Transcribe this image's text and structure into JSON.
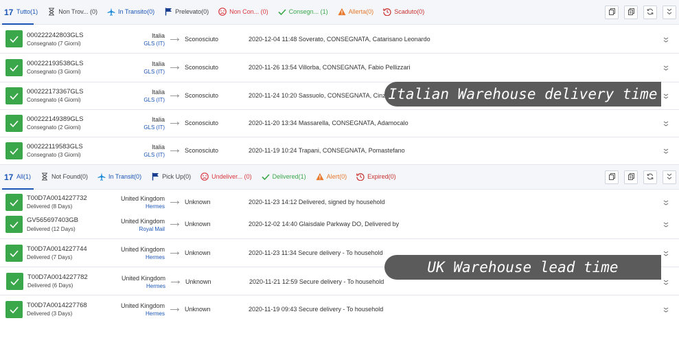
{
  "italy": {
    "tabs": [
      {
        "label": "Tutto(1)",
        "icon": "logo-17track-icon",
        "active": true
      },
      {
        "label": "Non Trov... (0)",
        "icon": "hourglass-icon"
      },
      {
        "label": "In Transito(0)",
        "icon": "plane-icon"
      },
      {
        "label": "Prelevato(0)",
        "icon": "flag-icon"
      },
      {
        "label": "Non Con... (0)",
        "icon": "sad-face-icon"
      },
      {
        "label": "Consegn... (1)",
        "icon": "check-icon"
      },
      {
        "label": "Allerta(0)",
        "icon": "warning-icon"
      },
      {
        "label": "Scaduto(0)",
        "icon": "history-icon"
      }
    ],
    "rows": [
      {
        "number": "000222242803GLS",
        "status": "Consegnato (7 Giorni)",
        "country": "Italia",
        "carrier": "GLS (IT)",
        "destination": "Sconosciuto",
        "event": "2020-12-04 11:48  Soverato, CONSEGNATA, Catarisano Leonardo"
      },
      {
        "number": "000222193538GLS",
        "status": "Consegnato (3 Giorni)",
        "country": "Italia",
        "carrier": "GLS (IT)",
        "destination": "Sconosciuto",
        "event": "2020-11-26 13:54  Villorba, CONSEGNATA, Fabio Pellizzari"
      },
      {
        "number": "000222173367GLS",
        "status": "Consegnato (4 Giorni)",
        "country": "Italia",
        "carrier": "GLS (IT)",
        "destination": "Sconosciuto",
        "event": "2020-11-24 10:20  Sassuolo, CONSEGNATA, Cinzia"
      },
      {
        "number": "000222149389GLS",
        "status": "Consegnato (2 Giorni)",
        "country": "Italia",
        "carrier": "GLS (IT)",
        "destination": "Sconosciuto",
        "event": "2020-11-20 13:34  Massarella, CONSEGNATA, Adamocalo"
      },
      {
        "number": "000222119583GLS",
        "status": "Consegnato (3 Giorni)",
        "country": "Italia",
        "carrier": "GLS (IT)",
        "destination": "Sconosciuto",
        "event": "2020-11-19 10:24  Trapani, CONSEGNATA, Pomastefano"
      }
    ],
    "banner": "Italian Warehouse delivery time"
  },
  "uk": {
    "tabs": [
      {
        "label": "All(1)",
        "icon": "logo-17track-icon",
        "active": true
      },
      {
        "label": "Not Found(0)",
        "icon": "hourglass-icon"
      },
      {
        "label": "In Transit(0)",
        "icon": "plane-icon"
      },
      {
        "label": "Pick Up(0)",
        "icon": "flag-icon"
      },
      {
        "label": "Undeliver... (0)",
        "icon": "sad-face-icon"
      },
      {
        "label": "Delivered(1)",
        "icon": "check-icon"
      },
      {
        "label": "Alert(0)",
        "icon": "warning-icon"
      },
      {
        "label": "Expired(0)",
        "icon": "history-icon"
      }
    ],
    "rows": [
      {
        "number": "T00D7A0014227732",
        "status": "Delivered (8 Days)",
        "country": "United Kingdom",
        "carrier": "Hermes",
        "destination": "Unknown",
        "event": "2020-11-23 14:12  Delivered, signed by household"
      },
      {
        "number": "GV565697403GB",
        "status": "Delivered (12 Days)",
        "country": "United Kingdom",
        "carrier": "Royal Mail",
        "destination": "Unknown",
        "event": "2020-12-02 14:40  Glaisdale Parkway DO, Delivered by"
      },
      {
        "number": "T00D7A0014227744",
        "status": "Delivered (7 Days)",
        "country": "United Kingdom",
        "carrier": "Hermes",
        "destination": "Unknown",
        "event": "2020-11-23 11:34  Secure delivery - To household"
      },
      {
        "number": "T00D7A0014227782",
        "status": "Delivered (6 Days)",
        "country": "United Kingdom",
        "carrier": "Hermes",
        "destination": "Unknown",
        "event": "2020-11-21 12:59  Secure delivery - To household"
      },
      {
        "number": "T00D7A0014227768",
        "status": "Delivered (3 Days)",
        "country": "United Kingdom",
        "carrier": "Hermes",
        "destination": "Unknown",
        "event": "2020-11-19 09:43  Secure delivery - To household"
      }
    ],
    "banner": "UK Warehouse lead time"
  },
  "colors": {
    "accent": "#1a54b7",
    "delivered": "#3aa74a",
    "alert": "#e8782a",
    "undelivered": "#d9363e",
    "banner": "#5b5b5b"
  },
  "toolbar_icons": [
    "copy-icon",
    "copy-all-icon",
    "refresh-icon",
    "collapse-icon"
  ]
}
